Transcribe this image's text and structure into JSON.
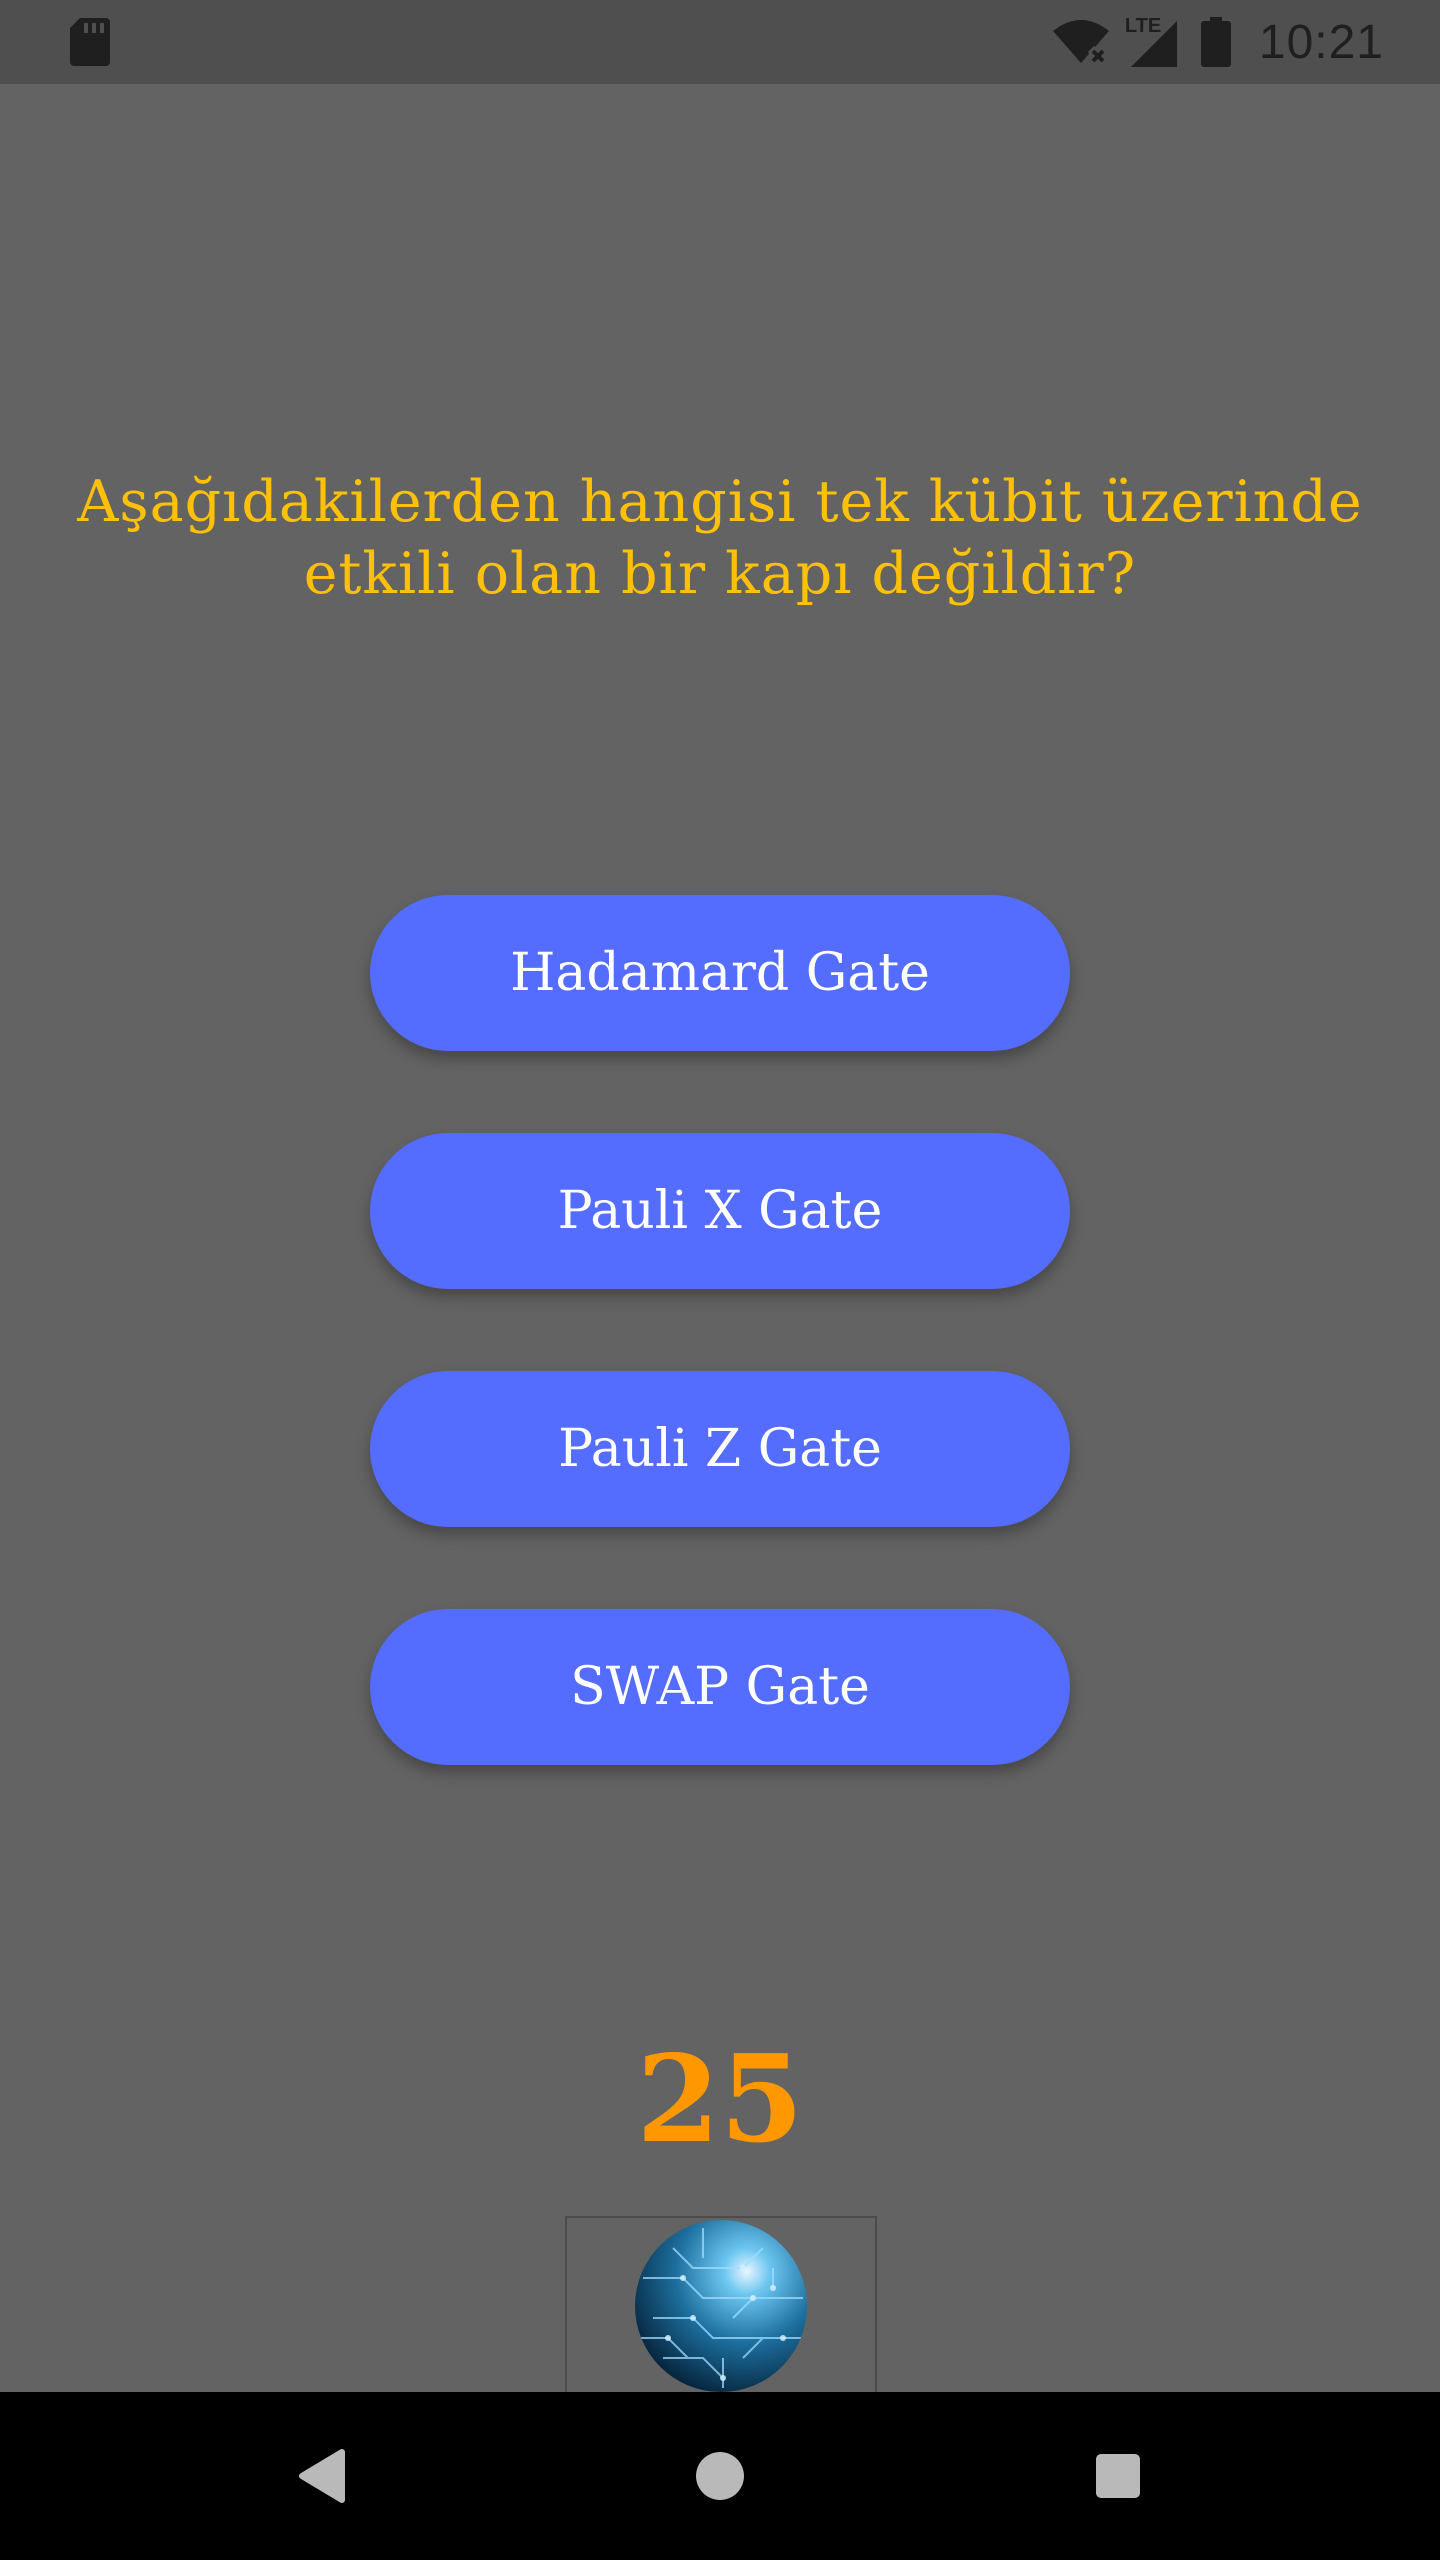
{
  "status_bar": {
    "time": "10:21",
    "network_label": "LTE",
    "icons": [
      "sd-card-icon",
      "wifi-off-icon",
      "lte-signal-icon",
      "battery-icon"
    ]
  },
  "question": {
    "text": "Aşağıdakilerden hangisi tek kübit üzerinde etkili olan bir kapı değildir?"
  },
  "answers": [
    {
      "label": "Hadamard Gate"
    },
    {
      "label": "Pauli X Gate"
    },
    {
      "label": "Pauli Z Gate"
    },
    {
      "label": "SWAP Gate"
    }
  ],
  "timer": {
    "value": "25"
  },
  "image": {
    "icon": "circuit-globe-icon"
  },
  "navigation": {
    "icons": [
      "back-icon",
      "home-icon",
      "recents-icon"
    ]
  },
  "colors": {
    "background": "#636363",
    "status_bar": "#4f4f4f",
    "question_text": "#ffc107",
    "button": "#546dfe",
    "button_text": "#ffffff",
    "timer": "#ff9800",
    "nav_bar": "#000000"
  }
}
